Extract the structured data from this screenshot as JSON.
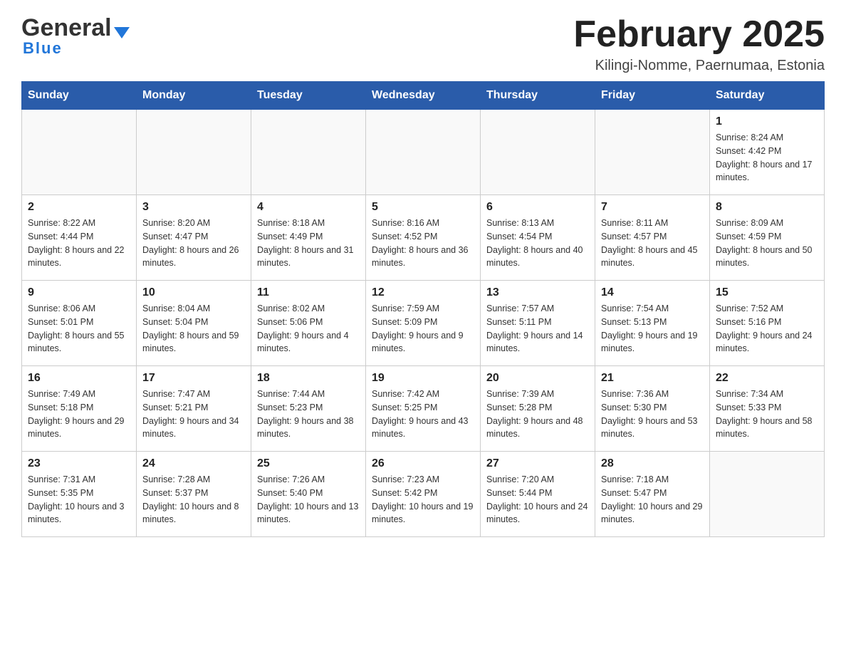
{
  "header": {
    "logo_general": "General",
    "logo_blue": "Blue",
    "month_title": "February 2025",
    "location": "Kilingi-Nomme, Paernumaa, Estonia"
  },
  "days_of_week": [
    "Sunday",
    "Monday",
    "Tuesday",
    "Wednesday",
    "Thursday",
    "Friday",
    "Saturday"
  ],
  "weeks": [
    [
      {
        "day": "",
        "info": ""
      },
      {
        "day": "",
        "info": ""
      },
      {
        "day": "",
        "info": ""
      },
      {
        "day": "",
        "info": ""
      },
      {
        "day": "",
        "info": ""
      },
      {
        "day": "",
        "info": ""
      },
      {
        "day": "1",
        "info": "Sunrise: 8:24 AM\nSunset: 4:42 PM\nDaylight: 8 hours and 17 minutes."
      }
    ],
    [
      {
        "day": "2",
        "info": "Sunrise: 8:22 AM\nSunset: 4:44 PM\nDaylight: 8 hours and 22 minutes."
      },
      {
        "day": "3",
        "info": "Sunrise: 8:20 AM\nSunset: 4:47 PM\nDaylight: 8 hours and 26 minutes."
      },
      {
        "day": "4",
        "info": "Sunrise: 8:18 AM\nSunset: 4:49 PM\nDaylight: 8 hours and 31 minutes."
      },
      {
        "day": "5",
        "info": "Sunrise: 8:16 AM\nSunset: 4:52 PM\nDaylight: 8 hours and 36 minutes."
      },
      {
        "day": "6",
        "info": "Sunrise: 8:13 AM\nSunset: 4:54 PM\nDaylight: 8 hours and 40 minutes."
      },
      {
        "day": "7",
        "info": "Sunrise: 8:11 AM\nSunset: 4:57 PM\nDaylight: 8 hours and 45 minutes."
      },
      {
        "day": "8",
        "info": "Sunrise: 8:09 AM\nSunset: 4:59 PM\nDaylight: 8 hours and 50 minutes."
      }
    ],
    [
      {
        "day": "9",
        "info": "Sunrise: 8:06 AM\nSunset: 5:01 PM\nDaylight: 8 hours and 55 minutes."
      },
      {
        "day": "10",
        "info": "Sunrise: 8:04 AM\nSunset: 5:04 PM\nDaylight: 8 hours and 59 minutes."
      },
      {
        "day": "11",
        "info": "Sunrise: 8:02 AM\nSunset: 5:06 PM\nDaylight: 9 hours and 4 minutes."
      },
      {
        "day": "12",
        "info": "Sunrise: 7:59 AM\nSunset: 5:09 PM\nDaylight: 9 hours and 9 minutes."
      },
      {
        "day": "13",
        "info": "Sunrise: 7:57 AM\nSunset: 5:11 PM\nDaylight: 9 hours and 14 minutes."
      },
      {
        "day": "14",
        "info": "Sunrise: 7:54 AM\nSunset: 5:13 PM\nDaylight: 9 hours and 19 minutes."
      },
      {
        "day": "15",
        "info": "Sunrise: 7:52 AM\nSunset: 5:16 PM\nDaylight: 9 hours and 24 minutes."
      }
    ],
    [
      {
        "day": "16",
        "info": "Sunrise: 7:49 AM\nSunset: 5:18 PM\nDaylight: 9 hours and 29 minutes."
      },
      {
        "day": "17",
        "info": "Sunrise: 7:47 AM\nSunset: 5:21 PM\nDaylight: 9 hours and 34 minutes."
      },
      {
        "day": "18",
        "info": "Sunrise: 7:44 AM\nSunset: 5:23 PM\nDaylight: 9 hours and 38 minutes."
      },
      {
        "day": "19",
        "info": "Sunrise: 7:42 AM\nSunset: 5:25 PM\nDaylight: 9 hours and 43 minutes."
      },
      {
        "day": "20",
        "info": "Sunrise: 7:39 AM\nSunset: 5:28 PM\nDaylight: 9 hours and 48 minutes."
      },
      {
        "day": "21",
        "info": "Sunrise: 7:36 AM\nSunset: 5:30 PM\nDaylight: 9 hours and 53 minutes."
      },
      {
        "day": "22",
        "info": "Sunrise: 7:34 AM\nSunset: 5:33 PM\nDaylight: 9 hours and 58 minutes."
      }
    ],
    [
      {
        "day": "23",
        "info": "Sunrise: 7:31 AM\nSunset: 5:35 PM\nDaylight: 10 hours and 3 minutes."
      },
      {
        "day": "24",
        "info": "Sunrise: 7:28 AM\nSunset: 5:37 PM\nDaylight: 10 hours and 8 minutes."
      },
      {
        "day": "25",
        "info": "Sunrise: 7:26 AM\nSunset: 5:40 PM\nDaylight: 10 hours and 13 minutes."
      },
      {
        "day": "26",
        "info": "Sunrise: 7:23 AM\nSunset: 5:42 PM\nDaylight: 10 hours and 19 minutes."
      },
      {
        "day": "27",
        "info": "Sunrise: 7:20 AM\nSunset: 5:44 PM\nDaylight: 10 hours and 24 minutes."
      },
      {
        "day": "28",
        "info": "Sunrise: 7:18 AM\nSunset: 5:47 PM\nDaylight: 10 hours and 29 minutes."
      },
      {
        "day": "",
        "info": ""
      }
    ]
  ]
}
